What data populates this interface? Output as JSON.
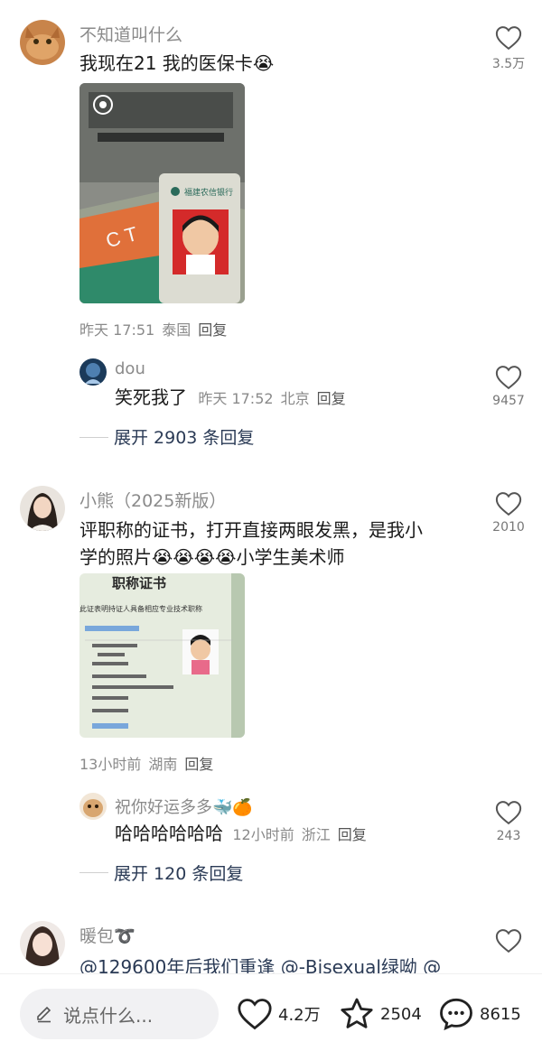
{
  "comments": [
    {
      "username": "不知道叫什么",
      "text": "我现在21 我的医保卡",
      "emoji": "😭",
      "time": "昨天 17:51",
      "location": "泰国",
      "reply_label": "回复",
      "likes": "3.5万",
      "card_bank_name": "福建农信银行",
      "sign_text": "C T",
      "replies": [
        {
          "username": "dou",
          "text": "笑死我了",
          "time": "昨天 17:52",
          "location": "北京",
          "reply_label": "回复",
          "likes": "9457"
        }
      ],
      "expand_text": "展开 2903 条回复"
    },
    {
      "username": "小熊（2025新版）",
      "text_line1": "评职称的证书，打开直接两眼发黑，是我小",
      "text_line2": "学的照片",
      "emojis": "😭😭😭😭",
      "text_after": "小学生美术师",
      "time": "13小时前",
      "location": "湖南",
      "reply_label": "回复",
      "likes": "2010",
      "cert_title": "职称证书",
      "cert_subtitle": "此证表明持证人具备相应专业技术职称",
      "replies": [
        {
          "username": "祝你好运多多",
          "username_emojis": "🐳🍊",
          "text": "哈哈哈哈哈哈",
          "time": "12小时前",
          "location": "浙江",
          "reply_label": "回复",
          "likes": "243"
        }
      ],
      "expand_text": "展开 120 条回复"
    },
    {
      "username": "暖包",
      "username_symbol": "➰",
      "text": "@129600年后我们重逢 @-Bisexual绿呦 @"
    }
  ],
  "bottom_bar": {
    "input_placeholder": "说点什么...",
    "likes": "4.2万",
    "favorites": "2504",
    "comments": "8615"
  },
  "colors": {
    "text_primary": "#1a1a1a",
    "text_secondary": "#8a8a8a",
    "expand_link": "#2a3a55",
    "input_bg": "#f1f1f3"
  },
  "icons": [
    "heart-icon",
    "star-icon",
    "comment-bubble-icon",
    "pencil-icon",
    "play-circle-icon"
  ]
}
